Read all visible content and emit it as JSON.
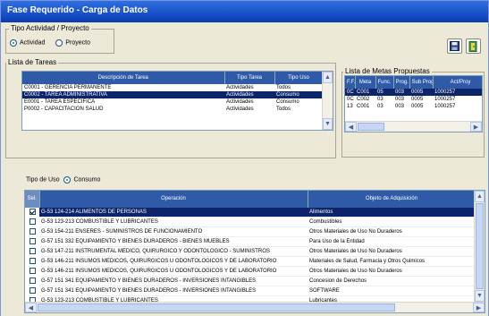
{
  "window": {
    "title": "Fase Requerido - Carga de Datos"
  },
  "tipo_actividad": {
    "title": "Tipo Actividad / Proyecto",
    "options": [
      {
        "label": "Actividad",
        "selected": true
      },
      {
        "label": "Proyecto",
        "selected": false
      }
    ]
  },
  "toolbar": {
    "save_icon": "floppy-disk-icon",
    "exit_icon": "exit-door-icon"
  },
  "lista_tareas": {
    "title": "Lista de Tareas",
    "columns": [
      "Descripción de Tarea",
      "Tipo Tarea",
      "Tipo Uso"
    ],
    "rows": [
      {
        "desc": "C0001 - GERENCIA PERMANENTE",
        "tipo": "Actividades",
        "uso": "Todos",
        "selected": false
      },
      {
        "desc": "C0002 - TAREA ADMINISTRATIVA",
        "tipo": "Actividades",
        "uso": "Consumo",
        "selected": true
      },
      {
        "desc": "E0001 - TAREA ESPECIFICA",
        "tipo": "Actividades",
        "uso": "Consumo",
        "selected": false
      },
      {
        "desc": "P0002 - CAPACITACION SALUD",
        "tipo": "Actividades",
        "uso": "Todos",
        "selected": false
      }
    ]
  },
  "lista_metas": {
    "title": "Lista de Metas Propuestas",
    "columns": [
      "F.F.",
      "Meta",
      "Func.",
      "Prog.",
      "Sub Prog.",
      "Act/Proy"
    ],
    "rows": [
      {
        "ff": "0C",
        "meta": "C001",
        "func": "05",
        "prog": "003",
        "sub": "0005",
        "act": "1000257",
        "selected": true
      },
      {
        "ff": "0C",
        "meta": "C002",
        "func": "03",
        "prog": "003",
        "sub": "0005",
        "act": "1000257",
        "selected": false
      },
      {
        "ff": "13",
        "meta": "C001",
        "func": "03",
        "prog": "003",
        "sub": "0005",
        "act": "1000257",
        "selected": false
      }
    ]
  },
  "tipo_uso": {
    "label": "Tipo de Uso",
    "option": "Consumo",
    "selected": true
  },
  "operaciones": {
    "columns": [
      "Sel.",
      "Operación",
      "Objeto de Adquisición"
    ],
    "rows": [
      {
        "checked": true,
        "op": "G-53 124-214  ALIMENTOS DE PERSONAS",
        "obj": "Alimentos",
        "selected": true
      },
      {
        "checked": false,
        "op": "G-53 123-213  COMBUSTIBLE Y LUBRICANTES",
        "obj": "Combustibles",
        "selected": false
      },
      {
        "checked": false,
        "op": "G-53 154-211  ENSERES - SUMINISTROS DE FUNCIONAMIENTO",
        "obj": "Otros Materiales de Uso No Duraderos",
        "selected": false
      },
      {
        "checked": false,
        "op": "G-57 151 332  EQUIPAMIENTO Y BIENES DURADEROS - BIENES MUEBLES",
        "obj": "Para Uso de la Entidad",
        "selected": false
      },
      {
        "checked": false,
        "op": "G-53 147-211  INSTRUMENTAL MEDICO, QUIRURGICO Y ODONTOLOGICO - SUMINISTROS",
        "obj": "Otros Materiales de Uso No Duraderos",
        "selected": false
      },
      {
        "checked": false,
        "op": "G-53 146-211  INSUMOS MEDICOS, QUIRURGICOS U ODONTOLOGICOS Y DE LABORATORIO",
        "obj": "Materiales de Salud, Farmacia y Otros Quimicos",
        "selected": false
      },
      {
        "checked": false,
        "op": "G-53 146-211  INSUMOS MEDICOS, QUIRURGICOS U ODONTOLOGICOS Y DE LABORATORIO",
        "obj": "Otros Materiales de Uso No Duraderos",
        "selected": false
      },
      {
        "checked": false,
        "op": "G-57 151 341  EQUIPAMIENTO Y BIENES DURADEROS - INVERSIONES INTANGIBLES",
        "obj": "Concesion de Derechos",
        "selected": false
      },
      {
        "checked": false,
        "op": "G-57 151 341  EQUIPAMIENTO Y BIENES DURADEROS - INVERSIONES INTANGIBLES",
        "obj": "SOFTWARE",
        "selected": false
      },
      {
        "checked": false,
        "op": "G-53 123-213  COMBUSTIBLE Y LUBRICANTES",
        "obj": "Lubricantes",
        "selected": false
      }
    ]
  },
  "colors": {
    "header": "#2e5aa8",
    "selection": "#0b246a",
    "title_bar": "#0a3bb5"
  }
}
